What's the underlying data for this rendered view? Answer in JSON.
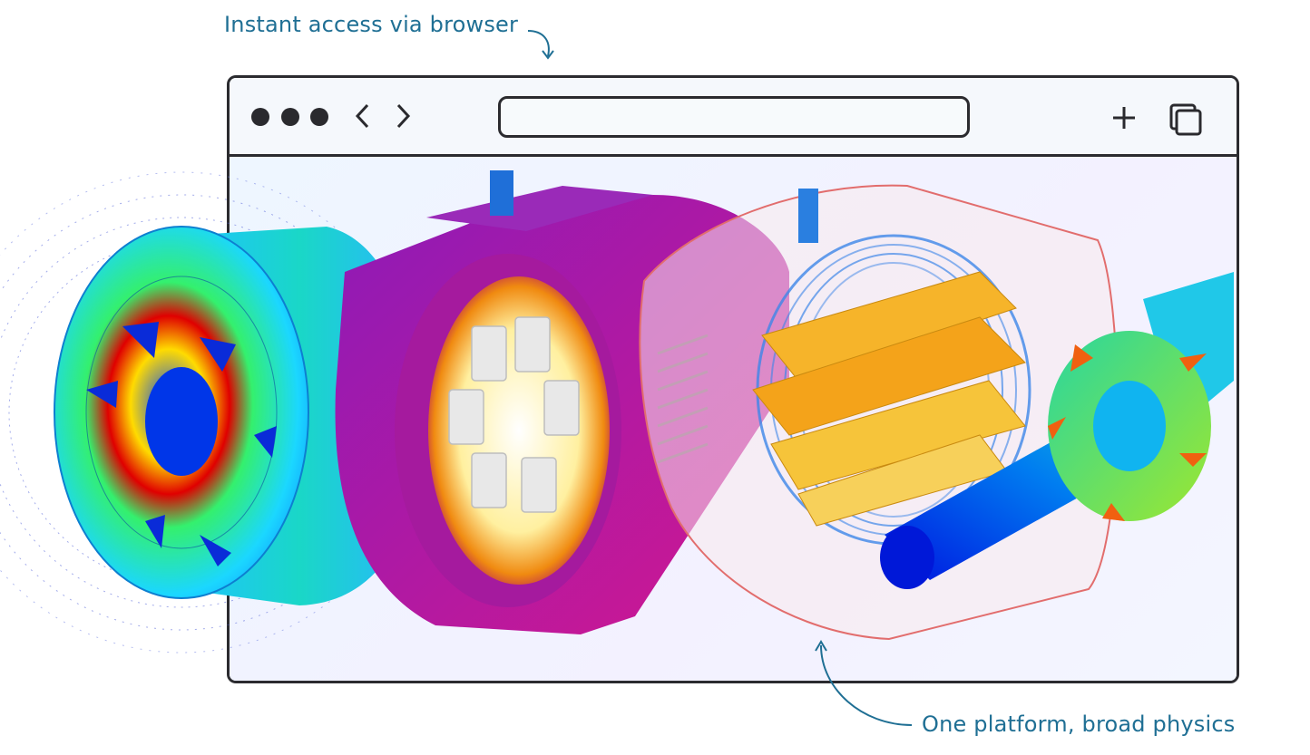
{
  "annotations": {
    "top": "Instant access via browser",
    "bottom": "One platform, broad physics"
  },
  "browser": {
    "icons": [
      "window-dot-icon",
      "window-dot-icon",
      "window-dot-icon",
      "chevron-left-icon",
      "chevron-right-icon",
      "plus-icon",
      "copy-windows-icon"
    ],
    "url": ""
  },
  "colors": {
    "annotation": "#1f6f94",
    "frame": "#2b2b2f"
  }
}
